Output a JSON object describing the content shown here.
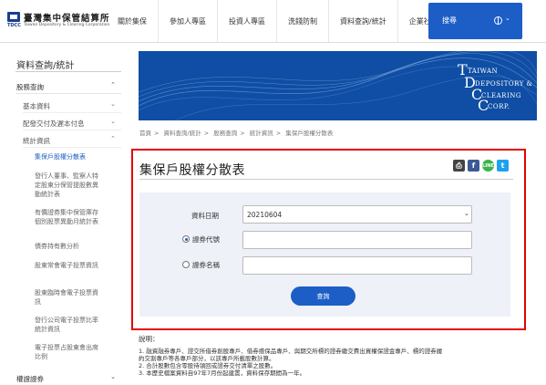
{
  "header": {
    "logo_cn": "臺灣集中保管結算所",
    "logo_en": "Taiwan Depository & Clearing Corporation",
    "logo_abbr": "TDCC",
    "nav": [
      "關於集保",
      "參加人專區",
      "投資人專區",
      "洗錢防制",
      "資料查詢/統計",
      "企業社會責任"
    ],
    "search_label": "搜尋"
  },
  "sidebar": {
    "title": "資料查詢/統計",
    "sections": [
      {
        "label": "股務查詢",
        "arrow": "up"
      },
      {
        "label": "基本資料",
        "arrow": "down"
      },
      {
        "label": "配發交付及遲本付息",
        "arrow": "down"
      },
      {
        "label": "統計資訊",
        "arrow": "up"
      }
    ],
    "leaves": [
      "集保戶股權分散表",
      "發行人董事、監察人特定股東分保管提股數異動統計表",
      "有價證券集中保管庫存個別股票異動月統計表",
      "債券持有數分析",
      "股東常會電子投票資訊",
      "股東臨時會電子投票資訊",
      "發行公司電子投票比率統計資訊",
      "電子投票占股東會出席比例"
    ],
    "footer_item": "權證證券"
  },
  "banner": {
    "line1": "TAIWAN",
    "line2": "DEPOSITORY &",
    "line3": "CLEARING",
    "line4": "CORP."
  },
  "breadcrumb": [
    "首頁",
    "資料查詢/統計",
    "股務查詢",
    "統計資訊",
    "集保戶股權分散表"
  ],
  "page_title": "集保戶股權分散表",
  "share": {
    "line_label": "LINE"
  },
  "form": {
    "date_label": "資料日期",
    "date_value": "20210604",
    "code_label": "證券代號",
    "name_label": "證券名稱",
    "selected_radio": "code",
    "code_value": "",
    "name_value": "",
    "query_label": "查詢"
  },
  "notes": {
    "title": "說明：",
    "items": [
      "1. 融資融券專戶、證交所借券創股專戶、借券擔保品專戶、與期交所標的證券繳交費出買權保證金專戶、標的證券履",
      "    約交割專戶等各專戶部分，以該專戶所載股數計算。",
      "2. 合計股數包含零股待領回或證券交付清單之股數。",
      "3. 本歷史檔案資料自97年7月份起建置，資料保存期間為一年。"
    ]
  },
  "colors": {
    "brand": "#1d5ec6",
    "banner": "#0f4ea4",
    "highlight_frame": "#e60000",
    "panel": "#eef1f7"
  }
}
